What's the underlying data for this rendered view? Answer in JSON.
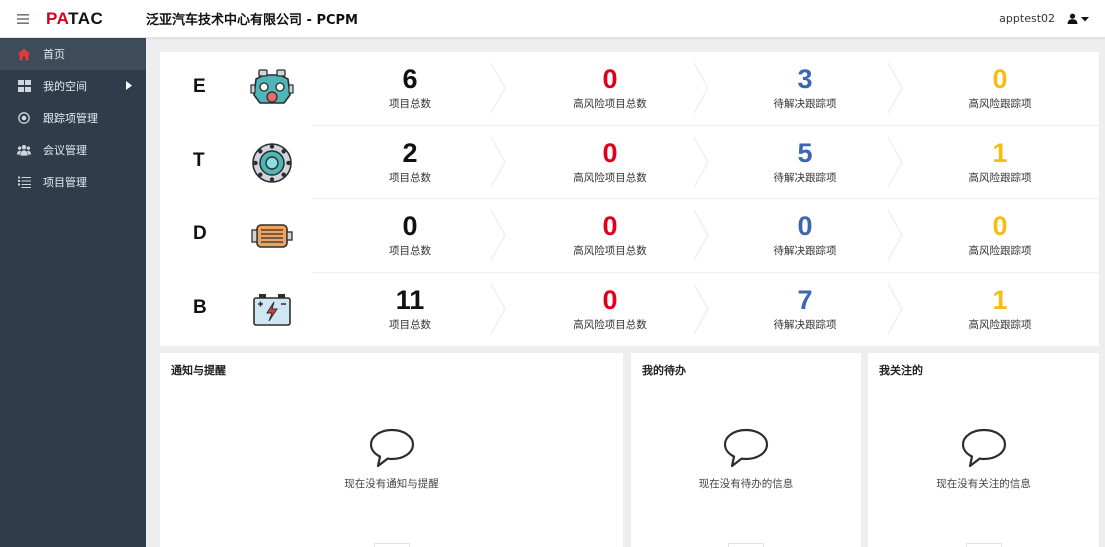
{
  "header": {
    "brand_prefix": "PA",
    "brand_suffix": "TAC",
    "title": "泛亚汽车技术中心有限公司 - PCPM",
    "username": "apptest02",
    "icons": {
      "menu": "hamburger-icon",
      "user": "user-icon",
      "dropdown": "caret-down-icon"
    }
  },
  "sidebar": {
    "items": [
      {
        "label": "首页",
        "icon": "home-icon",
        "active": true
      },
      {
        "label": "我的空间",
        "icon": "grid-icon",
        "has_children": true
      },
      {
        "label": "跟踪项管理",
        "icon": "target-icon"
      },
      {
        "label": "会议管理",
        "icon": "users-icon"
      },
      {
        "label": "项目管理",
        "icon": "list-icon"
      }
    ]
  },
  "stats": {
    "labels": {
      "total": "项目总数",
      "high_risk_projects": "高风险项目总数",
      "pending": "待解决跟踪项",
      "high_risk_items": "高风险跟踪项"
    },
    "rows": [
      {
        "letter": "E",
        "icon": "engine-icon",
        "total": "6",
        "high_risk_projects": "0",
        "pending": "3",
        "high_risk_items": "0"
      },
      {
        "letter": "T",
        "icon": "gear-icon",
        "total": "2",
        "high_risk_projects": "0",
        "pending": "5",
        "high_risk_items": "1"
      },
      {
        "letter": "D",
        "icon": "motor-icon",
        "total": "0",
        "high_risk_projects": "0",
        "pending": "0",
        "high_risk_items": "0"
      },
      {
        "letter": "B",
        "icon": "battery-icon",
        "total": "11",
        "high_risk_projects": "0",
        "pending": "7",
        "high_risk_items": "1"
      }
    ],
    "colors": {
      "total": "#111111",
      "high_risk_projects": "#e0001a",
      "pending": "#3a66b2",
      "high_risk_items": "#f5bd12"
    }
  },
  "cards": [
    {
      "title": "通知与提醒",
      "empty_message": "现在没有通知与提醒",
      "icon": "speech-bubble-icon"
    },
    {
      "title": "我的待办",
      "empty_message": "现在没有待办的信息",
      "icon": "speech-bubble-icon"
    },
    {
      "title": "我关注的",
      "empty_message": "现在没有关注的信息",
      "icon": "speech-bubble-icon"
    }
  ]
}
